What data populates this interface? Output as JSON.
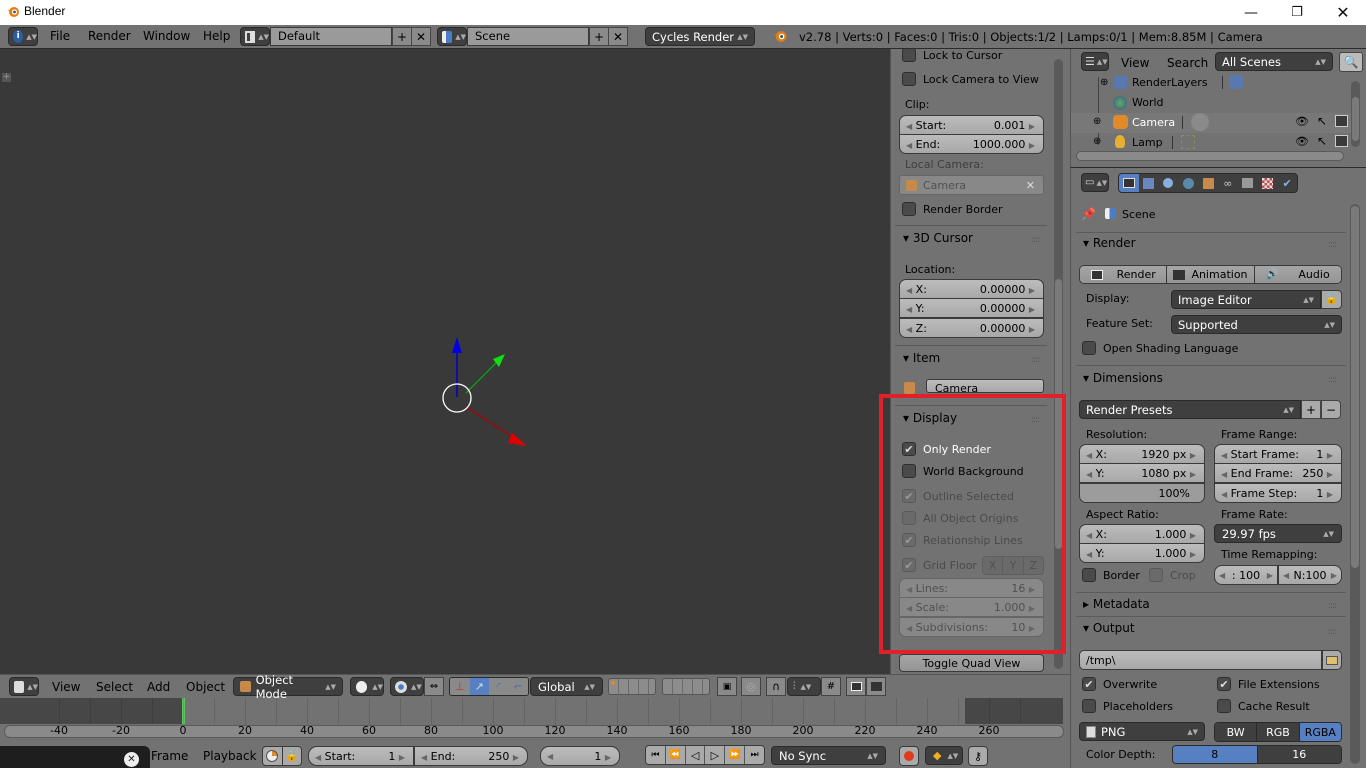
{
  "window": {
    "title": "Blender",
    "minimize_icon": "minimize-icon",
    "maximize_icon": "restore-icon",
    "close_icon": "close-icon"
  },
  "info_header": {
    "editor_icon": "info-icon",
    "menus": [
      "File",
      "Render",
      "Window",
      "Help"
    ],
    "screen_layout": "Default",
    "scene": "Scene",
    "render_engine": "Cycles Render",
    "stats": "v2.78 | Verts:0 | Faces:0 | Tris:0 | Objects:1/2 | Lamps:0/1 | Mem:8.85M | Camera"
  },
  "n_panel": {
    "lock_to_cursor": "Lock to Cursor",
    "lock_camera_to_view": "Lock Camera to View",
    "clip_label": "Clip:",
    "clip_start_label": "Start:",
    "clip_start_value": "0.001",
    "clip_end_label": "End:",
    "clip_end_value": "1000.000",
    "local_camera_label": "Local Camera:",
    "local_camera_value": "Camera",
    "render_border": "Render Border",
    "cursor_panel_title": "3D Cursor",
    "location_label": "Location:",
    "cursor_x_label": "X:",
    "cursor_x": "0.00000",
    "cursor_y_label": "Y:",
    "cursor_y": "0.00000",
    "cursor_z_label": "Z:",
    "cursor_z": "0.00000",
    "item_panel_title": "Item",
    "item_name": "Camera",
    "display_panel_title": "Display",
    "only_render": "Only Render",
    "only_render_checked": true,
    "world_background": "World Background",
    "world_background_checked": false,
    "outline_selected": "Outline Selected",
    "outline_selected_checked": true,
    "all_object_origins": "All Object Origins",
    "all_object_origins_checked": false,
    "relationship_lines": "Relationship Lines",
    "relationship_lines_checked": true,
    "grid_floor": "Grid Floor",
    "grid_floor_checked": true,
    "axis_x": "X",
    "axis_y": "Y",
    "axis_z": "Z",
    "lines_label": "Lines:",
    "lines_value": "16",
    "scale_label": "Scale:",
    "scale_value": "1.000",
    "subdivisions_label": "Subdivisions:",
    "subdivisions_value": "10",
    "toggle_quad_view": "Toggle Quad View",
    "highlight_color": "#e0212a"
  },
  "outliner": {
    "menus": [
      "View",
      "Search"
    ],
    "filter": "All Scenes",
    "items": [
      {
        "name": "RenderLayers",
        "icon": "render-layers-icon"
      },
      {
        "name": "World",
        "icon": "world-icon"
      },
      {
        "name": "Camera",
        "icon": "camera-icon"
      },
      {
        "name": "Lamp",
        "icon": "lamp-icon"
      }
    ]
  },
  "properties": {
    "context": "Scene",
    "render_panel": {
      "title": "Render",
      "render_btn": "Render",
      "animation_btn": "Animation",
      "audio_btn": "Audio",
      "display_label": "Display:",
      "display_value": "Image Editor",
      "feature_set_label": "Feature Set:",
      "feature_set_value": "Supported",
      "osl_label": "Open Shading Language"
    },
    "dimensions_panel": {
      "title": "Dimensions",
      "presets": "Render Presets",
      "resolution_label": "Resolution:",
      "res_x_label": "X:",
      "res_x": "1920 px",
      "res_y_label": "Y:",
      "res_y": "1080 px",
      "res_pct": "100%",
      "frame_range_label": "Frame Range:",
      "start_frame_label": "Start Frame:",
      "start_frame": "1",
      "end_frame_label": "End Frame:",
      "end_frame": "250",
      "frame_step_label": "Frame Step:",
      "frame_step": "1",
      "aspect_label": "Aspect Ratio:",
      "aspect_x_label": "X:",
      "aspect_x": "1.000",
      "aspect_y_label": "Y:",
      "aspect_y": "1.000",
      "frame_rate_label": "Frame Rate:",
      "frame_rate": "29.97 fps",
      "time_remap_label": "Time Remapping:",
      "remap_old": ": 100",
      "remap_new": "N:100",
      "border_label": "Border",
      "crop_label": "Crop"
    },
    "metadata_title": "Metadata",
    "output_panel": {
      "title": "Output",
      "path": "/tmp\\",
      "overwrite": "Overwrite",
      "file_extensions": "File Extensions",
      "placeholders": "Placeholders",
      "cache_result": "Cache Result",
      "format": "PNG",
      "bw": "BW",
      "rgb": "RGB",
      "rgba": "RGBA",
      "color_depth_label": "Color Depth:",
      "depth_8": "8",
      "depth_16": "16"
    }
  },
  "view3d_header": {
    "menus": [
      "View",
      "Select",
      "Add",
      "Object"
    ],
    "mode": "Object Mode",
    "orientation": "Global"
  },
  "timeline": {
    "ticks": [
      "-40",
      "-20",
      "0",
      "20",
      "40",
      "60",
      "80",
      "100",
      "120",
      "140",
      "160",
      "180",
      "200",
      "220",
      "240",
      "260"
    ],
    "current_frame": "1",
    "menus": [
      "Frame",
      "Playback"
    ],
    "start_label": "Start:",
    "start": "1",
    "end_label": "End:",
    "end": "250",
    "sync": "No Sync"
  }
}
